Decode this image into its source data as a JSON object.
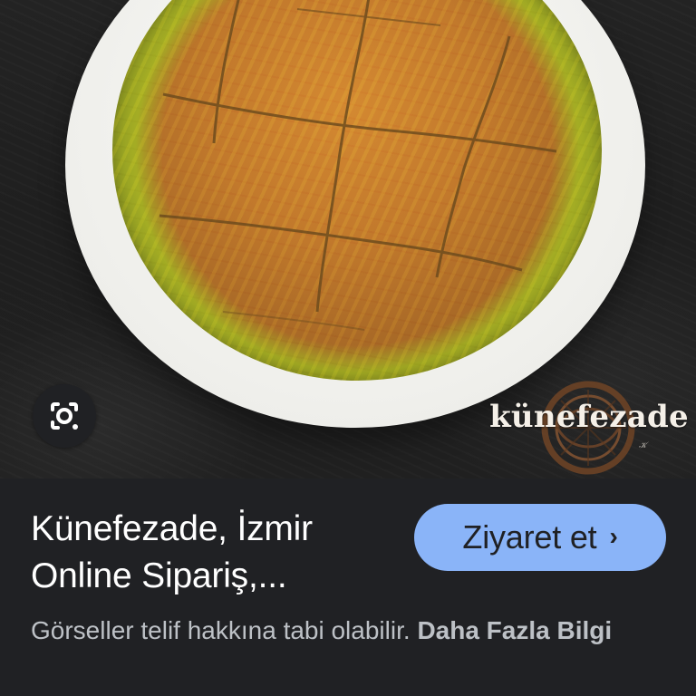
{
  "result": {
    "title_line_1": "Künefezade, İzmir",
    "title_line_2": "Online Sipariş,...",
    "visit_button": {
      "label": "Ziyaret et",
      "icon": "chevron-right-icon"
    },
    "disclaimer": "Görseller telif hakkına tabi olabilir.",
    "more_info_link": "Daha Fazla Bilgi"
  },
  "image": {
    "lens_icon": "google-lens-icon",
    "brand_logo_text": "künefezade"
  },
  "colors": {
    "background": "#202124",
    "button": "#8ab4f8",
    "primary_text": "#ffffff",
    "secondary_text": "#bdc1c6"
  }
}
